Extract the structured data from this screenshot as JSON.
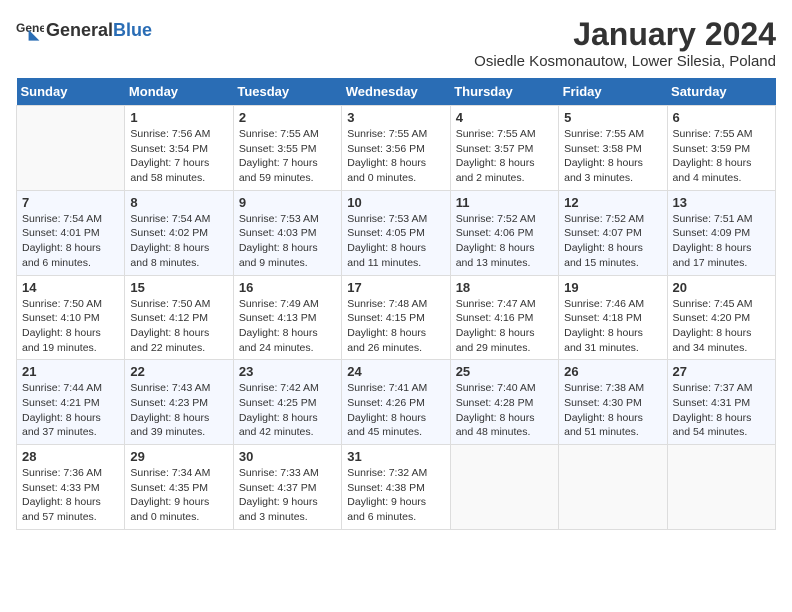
{
  "header": {
    "logo_general": "General",
    "logo_blue": "Blue",
    "month_title": "January 2024",
    "location": "Osiedle Kosmonautow, Lower Silesia, Poland"
  },
  "calendar": {
    "days_of_week": [
      "Sunday",
      "Monday",
      "Tuesday",
      "Wednesday",
      "Thursday",
      "Friday",
      "Saturday"
    ],
    "weeks": [
      [
        {
          "day": "",
          "info": ""
        },
        {
          "day": "1",
          "info": "Sunrise: 7:56 AM\nSunset: 3:54 PM\nDaylight: 7 hours\nand 58 minutes."
        },
        {
          "day": "2",
          "info": "Sunrise: 7:55 AM\nSunset: 3:55 PM\nDaylight: 7 hours\nand 59 minutes."
        },
        {
          "day": "3",
          "info": "Sunrise: 7:55 AM\nSunset: 3:56 PM\nDaylight: 8 hours\nand 0 minutes."
        },
        {
          "day": "4",
          "info": "Sunrise: 7:55 AM\nSunset: 3:57 PM\nDaylight: 8 hours\nand 2 minutes."
        },
        {
          "day": "5",
          "info": "Sunrise: 7:55 AM\nSunset: 3:58 PM\nDaylight: 8 hours\nand 3 minutes."
        },
        {
          "day": "6",
          "info": "Sunrise: 7:55 AM\nSunset: 3:59 PM\nDaylight: 8 hours\nand 4 minutes."
        }
      ],
      [
        {
          "day": "7",
          "info": "Sunrise: 7:54 AM\nSunset: 4:01 PM\nDaylight: 8 hours\nand 6 minutes."
        },
        {
          "day": "8",
          "info": "Sunrise: 7:54 AM\nSunset: 4:02 PM\nDaylight: 8 hours\nand 8 minutes."
        },
        {
          "day": "9",
          "info": "Sunrise: 7:53 AM\nSunset: 4:03 PM\nDaylight: 8 hours\nand 9 minutes."
        },
        {
          "day": "10",
          "info": "Sunrise: 7:53 AM\nSunset: 4:05 PM\nDaylight: 8 hours\nand 11 minutes."
        },
        {
          "day": "11",
          "info": "Sunrise: 7:52 AM\nSunset: 4:06 PM\nDaylight: 8 hours\nand 13 minutes."
        },
        {
          "day": "12",
          "info": "Sunrise: 7:52 AM\nSunset: 4:07 PM\nDaylight: 8 hours\nand 15 minutes."
        },
        {
          "day": "13",
          "info": "Sunrise: 7:51 AM\nSunset: 4:09 PM\nDaylight: 8 hours\nand 17 minutes."
        }
      ],
      [
        {
          "day": "14",
          "info": "Sunrise: 7:50 AM\nSunset: 4:10 PM\nDaylight: 8 hours\nand 19 minutes."
        },
        {
          "day": "15",
          "info": "Sunrise: 7:50 AM\nSunset: 4:12 PM\nDaylight: 8 hours\nand 22 minutes."
        },
        {
          "day": "16",
          "info": "Sunrise: 7:49 AM\nSunset: 4:13 PM\nDaylight: 8 hours\nand 24 minutes."
        },
        {
          "day": "17",
          "info": "Sunrise: 7:48 AM\nSunset: 4:15 PM\nDaylight: 8 hours\nand 26 minutes."
        },
        {
          "day": "18",
          "info": "Sunrise: 7:47 AM\nSunset: 4:16 PM\nDaylight: 8 hours\nand 29 minutes."
        },
        {
          "day": "19",
          "info": "Sunrise: 7:46 AM\nSunset: 4:18 PM\nDaylight: 8 hours\nand 31 minutes."
        },
        {
          "day": "20",
          "info": "Sunrise: 7:45 AM\nSunset: 4:20 PM\nDaylight: 8 hours\nand 34 minutes."
        }
      ],
      [
        {
          "day": "21",
          "info": "Sunrise: 7:44 AM\nSunset: 4:21 PM\nDaylight: 8 hours\nand 37 minutes."
        },
        {
          "day": "22",
          "info": "Sunrise: 7:43 AM\nSunset: 4:23 PM\nDaylight: 8 hours\nand 39 minutes."
        },
        {
          "day": "23",
          "info": "Sunrise: 7:42 AM\nSunset: 4:25 PM\nDaylight: 8 hours\nand 42 minutes."
        },
        {
          "day": "24",
          "info": "Sunrise: 7:41 AM\nSunset: 4:26 PM\nDaylight: 8 hours\nand 45 minutes."
        },
        {
          "day": "25",
          "info": "Sunrise: 7:40 AM\nSunset: 4:28 PM\nDaylight: 8 hours\nand 48 minutes."
        },
        {
          "day": "26",
          "info": "Sunrise: 7:38 AM\nSunset: 4:30 PM\nDaylight: 8 hours\nand 51 minutes."
        },
        {
          "day": "27",
          "info": "Sunrise: 7:37 AM\nSunset: 4:31 PM\nDaylight: 8 hours\nand 54 minutes."
        }
      ],
      [
        {
          "day": "28",
          "info": "Sunrise: 7:36 AM\nSunset: 4:33 PM\nDaylight: 8 hours\nand 57 minutes."
        },
        {
          "day": "29",
          "info": "Sunrise: 7:34 AM\nSunset: 4:35 PM\nDaylight: 9 hours\nand 0 minutes."
        },
        {
          "day": "30",
          "info": "Sunrise: 7:33 AM\nSunset: 4:37 PM\nDaylight: 9 hours\nand 3 minutes."
        },
        {
          "day": "31",
          "info": "Sunrise: 7:32 AM\nSunset: 4:38 PM\nDaylight: 9 hours\nand 6 minutes."
        },
        {
          "day": "",
          "info": ""
        },
        {
          "day": "",
          "info": ""
        },
        {
          "day": "",
          "info": ""
        }
      ]
    ]
  }
}
